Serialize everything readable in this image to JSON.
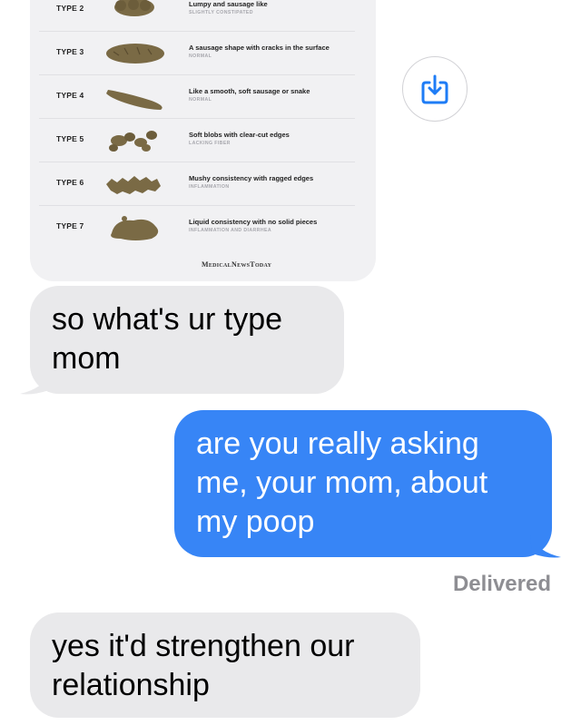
{
  "chart": {
    "rows": [
      {
        "type": "TYPE 2",
        "desc": "Lumpy and sausage like",
        "tag": "SLIGHTLY CONSTIPATED"
      },
      {
        "type": "TYPE 3",
        "desc": "A sausage shape with cracks in the surface",
        "tag": "NORMAL"
      },
      {
        "type": "TYPE 4",
        "desc": "Like a smooth, soft sausage or snake",
        "tag": "NORMAL"
      },
      {
        "type": "TYPE 5",
        "desc": "Soft blobs with clear-cut edges",
        "tag": "LACKING FIBER"
      },
      {
        "type": "TYPE 6",
        "desc": "Mushy consistency with ragged edges",
        "tag": "INFLAMMATION"
      },
      {
        "type": "TYPE 7",
        "desc": "Liquid consistency with no solid pieces",
        "tag": "INFLAMMATION AND DIARRHEA"
      }
    ],
    "credit": "MedicalNewsToday",
    "blob_color": "#7a6a45"
  },
  "messages": {
    "m1": {
      "lines": [
        "so what's ur type",
        "mom"
      ]
    },
    "m2": {
      "lines": [
        "are you really asking",
        "me, your mom, about",
        "my poop"
      ]
    },
    "m3": {
      "lines": [
        "yes it'd strengthen our",
        "relationship"
      ]
    }
  },
  "status": {
    "delivered": "Delivered"
  },
  "icons": {
    "save": "save-to-photos-icon"
  },
  "colors": {
    "incoming": "#e9e9eb",
    "outgoing": "#3785f6",
    "accent": "#1e7cf6"
  }
}
